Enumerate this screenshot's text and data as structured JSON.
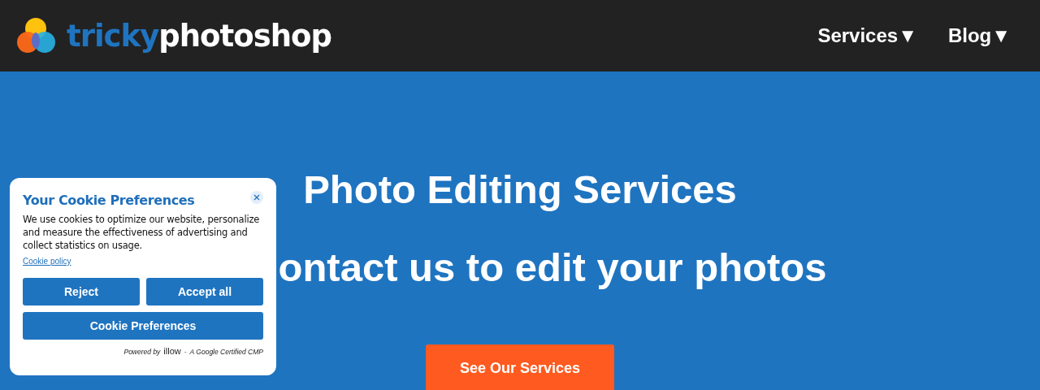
{
  "header": {
    "logo": {
      "part_1": "tricky",
      "part_2": "photoshop"
    },
    "nav": [
      {
        "label": "Services",
        "caret": "▼"
      },
      {
        "label": "Blog",
        "caret": "▼"
      }
    ]
  },
  "hero": {
    "title": "Photo Editing Services",
    "subtitle": "ontact us to edit your photos",
    "button": "See Our Services"
  },
  "cookie_dialog": {
    "title": "Your Cookie Preferences",
    "text": "We use cookies to optimize our website, personalize and measure the effectiveness of advertising and collect statistics on usage.",
    "policy_link": "Cookie policy",
    "buttons": [
      "Reject",
      "Accept all"
    ],
    "wide_button": "Cookie Preferences",
    "powered_by": "Powered by",
    "brand": "illow",
    "separator": "-",
    "certified": "A Google Certified CMP"
  }
}
